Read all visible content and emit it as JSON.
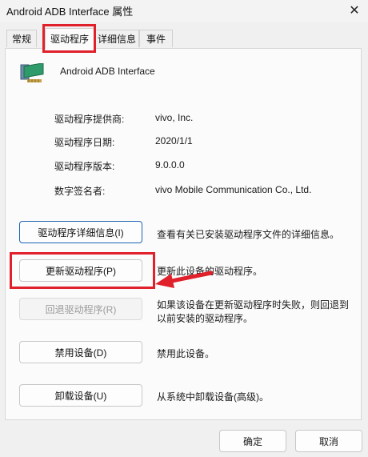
{
  "window": {
    "title": "Android ADB Interface 属性",
    "close_glyph": "✕"
  },
  "tabs": [
    {
      "label": "常规",
      "active": false
    },
    {
      "label": "驱动程序",
      "active": true
    },
    {
      "label": "详细信息",
      "active": false
    },
    {
      "label": "事件",
      "active": false
    }
  ],
  "device": {
    "name": "Android ADB Interface",
    "icon": "network-adapter-icon"
  },
  "properties": [
    {
      "label": "驱动程序提供商:",
      "value": "vivo, Inc."
    },
    {
      "label": "驱动程序日期:",
      "value": "2020/1/1"
    },
    {
      "label": "驱动程序版本:",
      "value": "9.0.0.0"
    },
    {
      "label": "数字签名者:",
      "value": "vivo Mobile Communication Co., Ltd."
    }
  ],
  "actions": [
    {
      "label": "驱动程序详细信息(I)",
      "description": "查看有关已安装驱动程序文件的详细信息。",
      "enabled": true
    },
    {
      "label": "更新驱动程序(P)",
      "description": "更新此设备的驱动程序。",
      "enabled": true
    },
    {
      "label": "回退驱动程序(R)",
      "description": "如果该设备在更新驱动程序时失败，则回退到以前安装的驱动程序。",
      "description_line1": "如果该设备在更新驱动程序时失败，则回退到",
      "description_line2": "以前安装的驱动程序。",
      "enabled": false
    },
    {
      "label": "禁用设备(D)",
      "description": "禁用此设备。",
      "enabled": true
    },
    {
      "label": "卸载设备(U)",
      "description": "从系统中卸载设备(高级)。",
      "enabled": true
    }
  ],
  "footer": {
    "ok_label": "确定",
    "cancel_label": "取消"
  },
  "colors": {
    "annotation_red": "#e0202a",
    "focus_blue": "#1a64b5"
  }
}
